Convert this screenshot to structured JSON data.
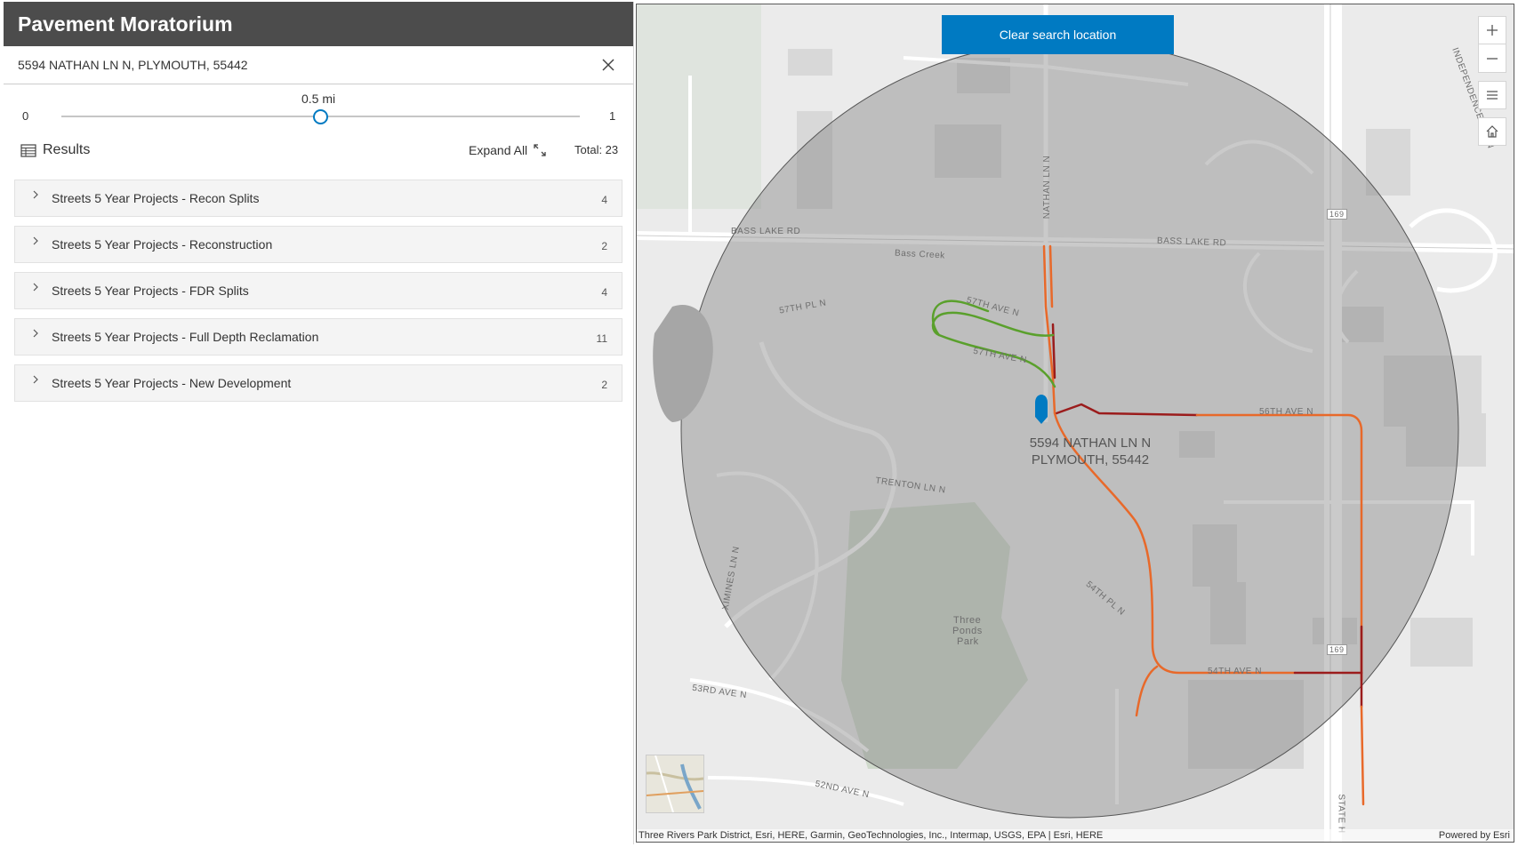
{
  "app": {
    "title": "Pavement Moratorium"
  },
  "search": {
    "value": "5594 NATHAN LN N, PLYMOUTH, 55442"
  },
  "slider": {
    "min": "0",
    "max": "1",
    "current": "0.5 mi",
    "fraction": 0.5
  },
  "results": {
    "label": "Results",
    "expand_label": "Expand All",
    "total": "Total: 23",
    "items": [
      {
        "label": "Streets 5 Year Projects - Recon Splits",
        "count": "4"
      },
      {
        "label": "Streets 5 Year Projects - Reconstruction",
        "count": "2"
      },
      {
        "label": "Streets 5 Year Projects - FDR Splits",
        "count": "4"
      },
      {
        "label": "Streets 5 Year Projects - Full Depth Reclamation",
        "count": "11"
      },
      {
        "label": "Streets 5 Year Projects - New Development",
        "count": "2"
      }
    ]
  },
  "map": {
    "clear_button": "Clear search location",
    "address_line1": "5594 NATHAN LN N",
    "address_line2": "PLYMOUTH, 55442",
    "road_labels": {
      "bass_lake_rd": "BASS LAKE RD",
      "bass_creek": "Bass Creek",
      "nathan_ln": "NATHAN LN N",
      "trenton_ln": "TRENTON LN N",
      "ximines_ln": "XIMINES LN N",
      "pl57": "57TH PL N",
      "ave57a": "57TH AVE N",
      "ave57b": "57TH AVE N",
      "ave56": "56TH AVE N",
      "pl54": "54TH PL N",
      "ave54": "54TH AVE N",
      "ave53": "53RD AVE N",
      "ave52": "52ND AVE N",
      "independence": "INDEPENDENCE AVE N",
      "hwy169a": "169",
      "hwy169b": "169",
      "park_1": "Three",
      "park_2": "Ponds",
      "park_3": "Park",
      "state": "STATE H"
    },
    "attribution": "Three Rivers Park District, Esri, HERE, Garmin, GeoTechnologies, Inc., Intermap, USGS, EPA | Esri, HERE",
    "powered_by": "Powered by Esri",
    "colors": {
      "accent": "#007ac2",
      "reclamation_orange": "#e8692a",
      "reconstruction_darkred": "#9b1c1c",
      "new_development_green": "#5aa02c",
      "buffer_fill": "rgba(128,128,128,0.45)"
    },
    "tools": [
      "zoom-in-icon",
      "zoom-out-icon",
      "legend-icon",
      "home-icon"
    ]
  }
}
